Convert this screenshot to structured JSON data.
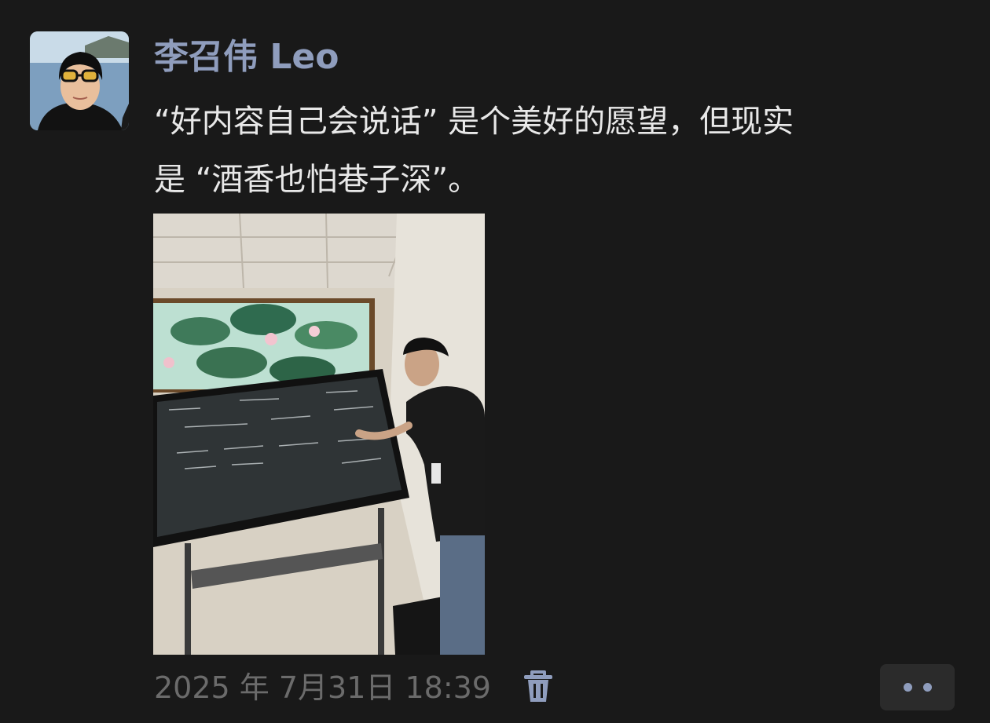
{
  "post": {
    "author_name": "李召伟 Leo",
    "text_line_1": "“好内容自己会说话” 是个美好的愿望，但现实",
    "text_line_2": "是 “酒香也怕巷子深”。",
    "timestamp": "2025 年 7月31日 18:39"
  },
  "icons": {
    "delete": "trash-icon",
    "more": "ellipsis-icon"
  },
  "colors": {
    "background": "#191919",
    "author_name": "#8f9dbd",
    "body_text": "#e8e8e8",
    "timestamp": "#6b6b6b",
    "action_bg": "#2b2b2b"
  }
}
